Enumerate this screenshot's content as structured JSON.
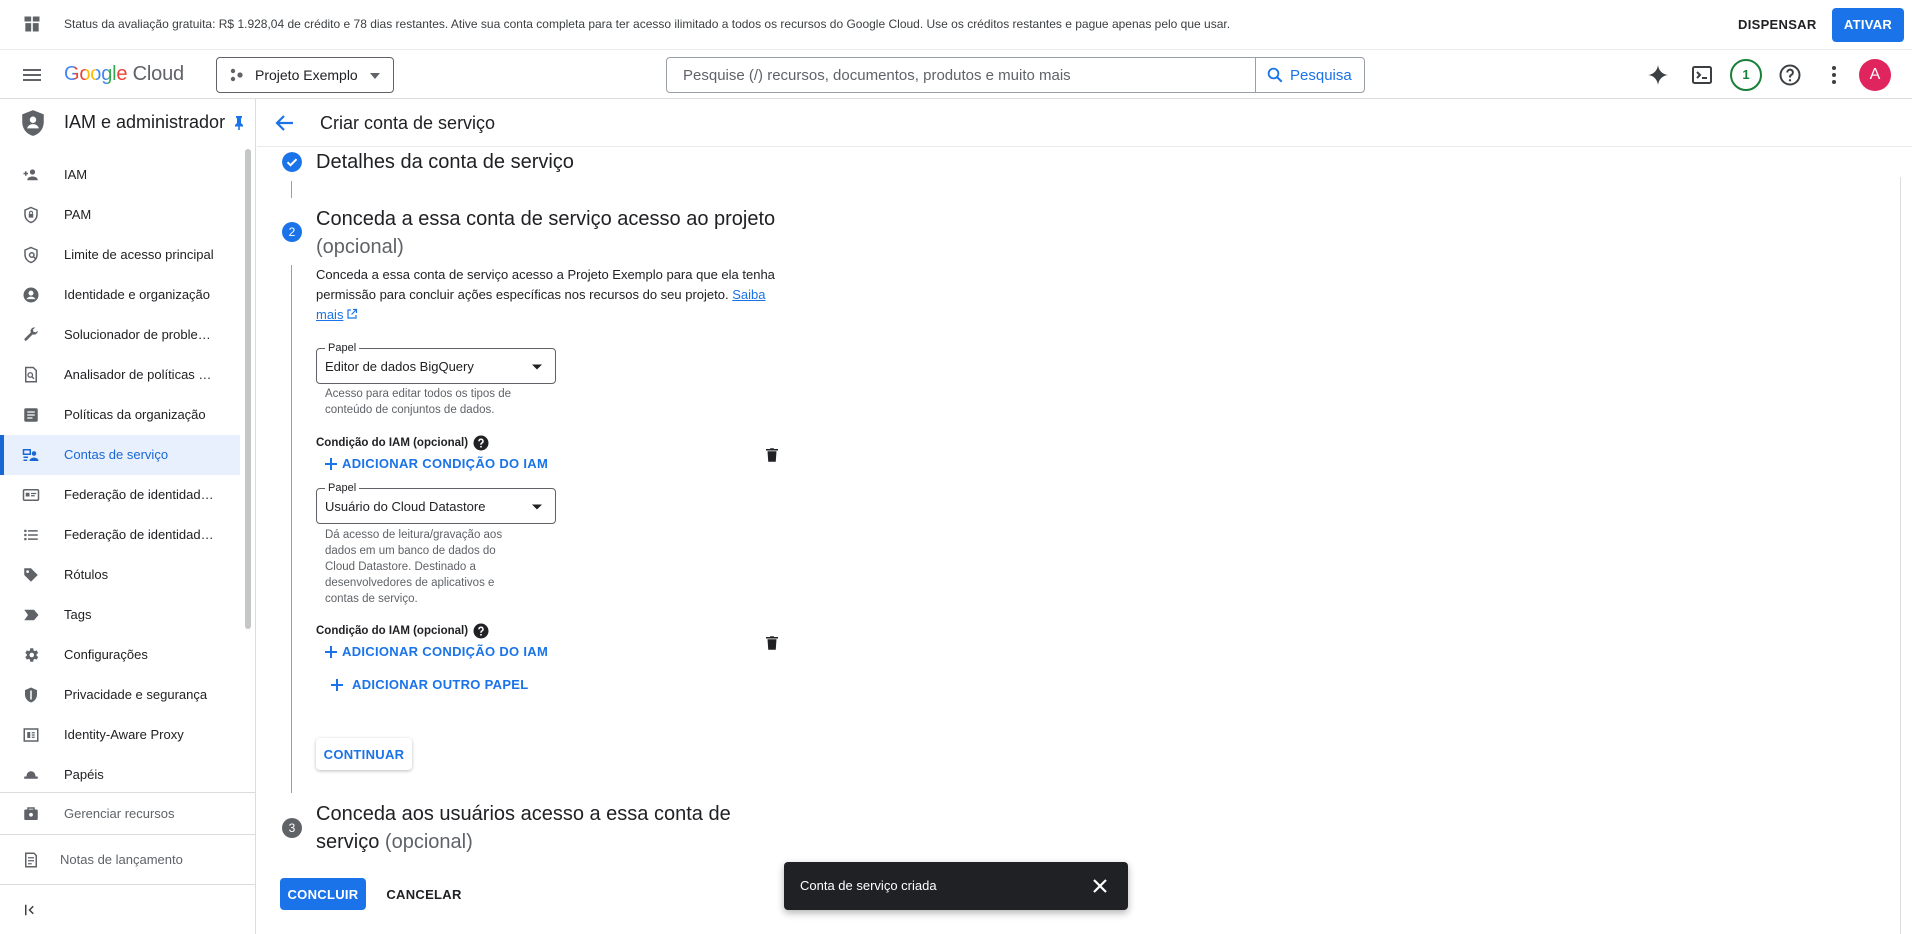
{
  "banner": {
    "status": "Status da avaliação gratuita: R$ 1.928,04 de crédito e 78 dias restantes. Ative sua conta completa para ter acesso ilimitado a todos os recursos do Google Cloud. Use os créditos restantes e pague apenas pelo que usar.",
    "dismiss": "DISPENSAR",
    "activate": "ATIVAR"
  },
  "topbar": {
    "logo_google": "Google",
    "logo_cloud": "Cloud",
    "project": "Projeto Exemplo",
    "search_placeholder": "Pesquise (/) recursos, documentos, produtos e muito mais",
    "search_button": "Pesquisa",
    "notifications_count": "1",
    "avatar_letter": "A"
  },
  "sidebar": {
    "title": "IAM e administrador",
    "items": [
      {
        "label": "IAM",
        "icon": "person-add-icon"
      },
      {
        "label": "PAM",
        "icon": "shield-lock-icon"
      },
      {
        "label": "Limite de acesso principal",
        "icon": "policy-icon"
      },
      {
        "label": "Identidade e organização",
        "icon": "account-circle-icon"
      },
      {
        "label": "Solucionador de problem…",
        "icon": "wrench-icon"
      },
      {
        "label": "Analisador de políticas …",
        "icon": "doc-search-icon"
      },
      {
        "label": "Políticas da organização",
        "icon": "article-icon"
      },
      {
        "label": "Contas de serviço",
        "icon": "service-account-icon"
      },
      {
        "label": "Federação de identidade …",
        "icon": "id-card-icon"
      },
      {
        "label": "Federação de identidade …",
        "icon": "list-icon"
      },
      {
        "label": "Rótulos",
        "icon": "label-icon"
      },
      {
        "label": "Tags",
        "icon": "tag-arrow-icon"
      },
      {
        "label": "Configurações",
        "icon": "gear-icon"
      },
      {
        "label": "Privacidade e segurança",
        "icon": "shield-icon"
      },
      {
        "label": "Identity-Aware Proxy",
        "icon": "proxy-icon"
      },
      {
        "label": "Papéis",
        "icon": "hat-icon"
      }
    ],
    "manage_resources": "Gerenciar recursos",
    "release_notes": "Notas de lançamento"
  },
  "page": {
    "title": "Criar conta de serviço"
  },
  "steps": {
    "step1": {
      "title": "Detalhes da conta de serviço"
    },
    "step2": {
      "number": "2",
      "title": "Conceda a essa conta de serviço acesso ao projeto",
      "optional": "(opcional)",
      "description": "Conceda a essa conta de serviço acesso a Projeto Exemplo para que ela tenha permissão para concluir ações específicas nos recursos do seu projeto.",
      "learn_more": "Saiba mais"
    },
    "step3": {
      "number": "3",
      "title": "Conceda aos usuários acesso a essa conta de serviço",
      "optional": "(opcional)"
    }
  },
  "roles": [
    {
      "label": "Papel",
      "value": "Editor de dados BigQuery",
      "hint": "Acesso para editar todos os tipos de conteúdo de conjuntos de dados.",
      "condition_label": "Condição do IAM (opcional)",
      "add_condition": "ADICIONAR CONDIÇÃO DO IAM"
    },
    {
      "label": "Papel",
      "value": "Usuário do Cloud Datastore",
      "hint": "Dá acesso de leitura/gravação aos dados em um banco de dados do Cloud Datastore. Destinado a desenvolvedores de aplicativos e contas de serviço.",
      "condition_label": "Condição do IAM (opcional)",
      "add_condition": "ADICIONAR CONDIÇÃO DO IAM"
    }
  ],
  "actions": {
    "add_role": "ADICIONAR OUTRO PAPEL",
    "continue": "CONTINUAR",
    "done": "CONCLUIR",
    "cancel": "CANCELAR"
  },
  "toast": {
    "message": "Conta de serviço criada"
  },
  "colors": {
    "accent": "#1a73e8",
    "step_done": "#1a73e8",
    "step_pending": "#5f6368"
  }
}
